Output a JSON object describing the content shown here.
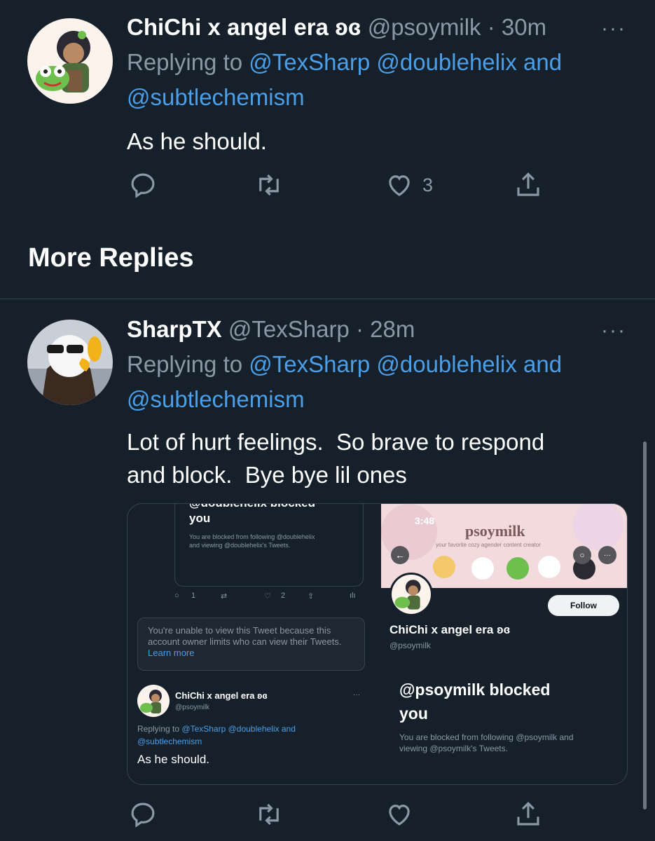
{
  "tweet1": {
    "name": "ChiChi x angel era ʚɞ",
    "handle": "@psoymilk",
    "time": "· 30m",
    "reply_prefix": "Replying to",
    "reply_to_1": "@TexSharp @doublehelix",
    "reply_and": "and",
    "reply_to_2": "@subtlechemism",
    "text": "As he should.",
    "likes": "3",
    "more": "···"
  },
  "section": {
    "title": "More Replies"
  },
  "tweet2": {
    "name": "SharpTX",
    "handle": "@TexSharp",
    "time": "· 28m",
    "reply_prefix": "Replying to",
    "reply_to_1": "@TexSharp @doublehelix",
    "reply_and": "and",
    "reply_to_2": "@subtlechemism",
    "text_line1": "Lot of hurt feelings.  So brave to respond",
    "text_line2": "and block.  Bye bye lil ones",
    "more": "···"
  },
  "embed": {
    "left": {
      "cut_heading": "@doublehelix blocked",
      "you": "you",
      "blocked_line1": "You are blocked from following @doublehelix",
      "blocked_line2": "and viewing @doublehelix's Tweets.",
      "reply_count": "1",
      "like_count": "2",
      "notice_line1": "You're unable to view this Tweet because this",
      "notice_line2": "account owner limits who can view their Tweets.",
      "learn_more": "Learn more",
      "name": "ChiChi x angel era ʚɞ",
      "handle": "@psoymilk",
      "more": "···",
      "reply_prefix": "Replying to",
      "reply_to_1": "@TexSharp @doublehelix",
      "reply_and": "and",
      "reply_to_2": "@subtlechemism",
      "text": "As he should."
    },
    "right": {
      "clock": "3:48",
      "banner_title": "psoymilk",
      "banner_sub": "your favorite cozy agender content creator",
      "follow": "Follow",
      "name": "ChiChi x angel era ʚɞ",
      "handle": "@psoymilk",
      "blocked_title_1": "@psoymilk blocked",
      "blocked_title_2": "you",
      "blocked_line1": "You are blocked from following @psoymilk and",
      "blocked_line2": "viewing @psoymilk's Tweets."
    }
  }
}
